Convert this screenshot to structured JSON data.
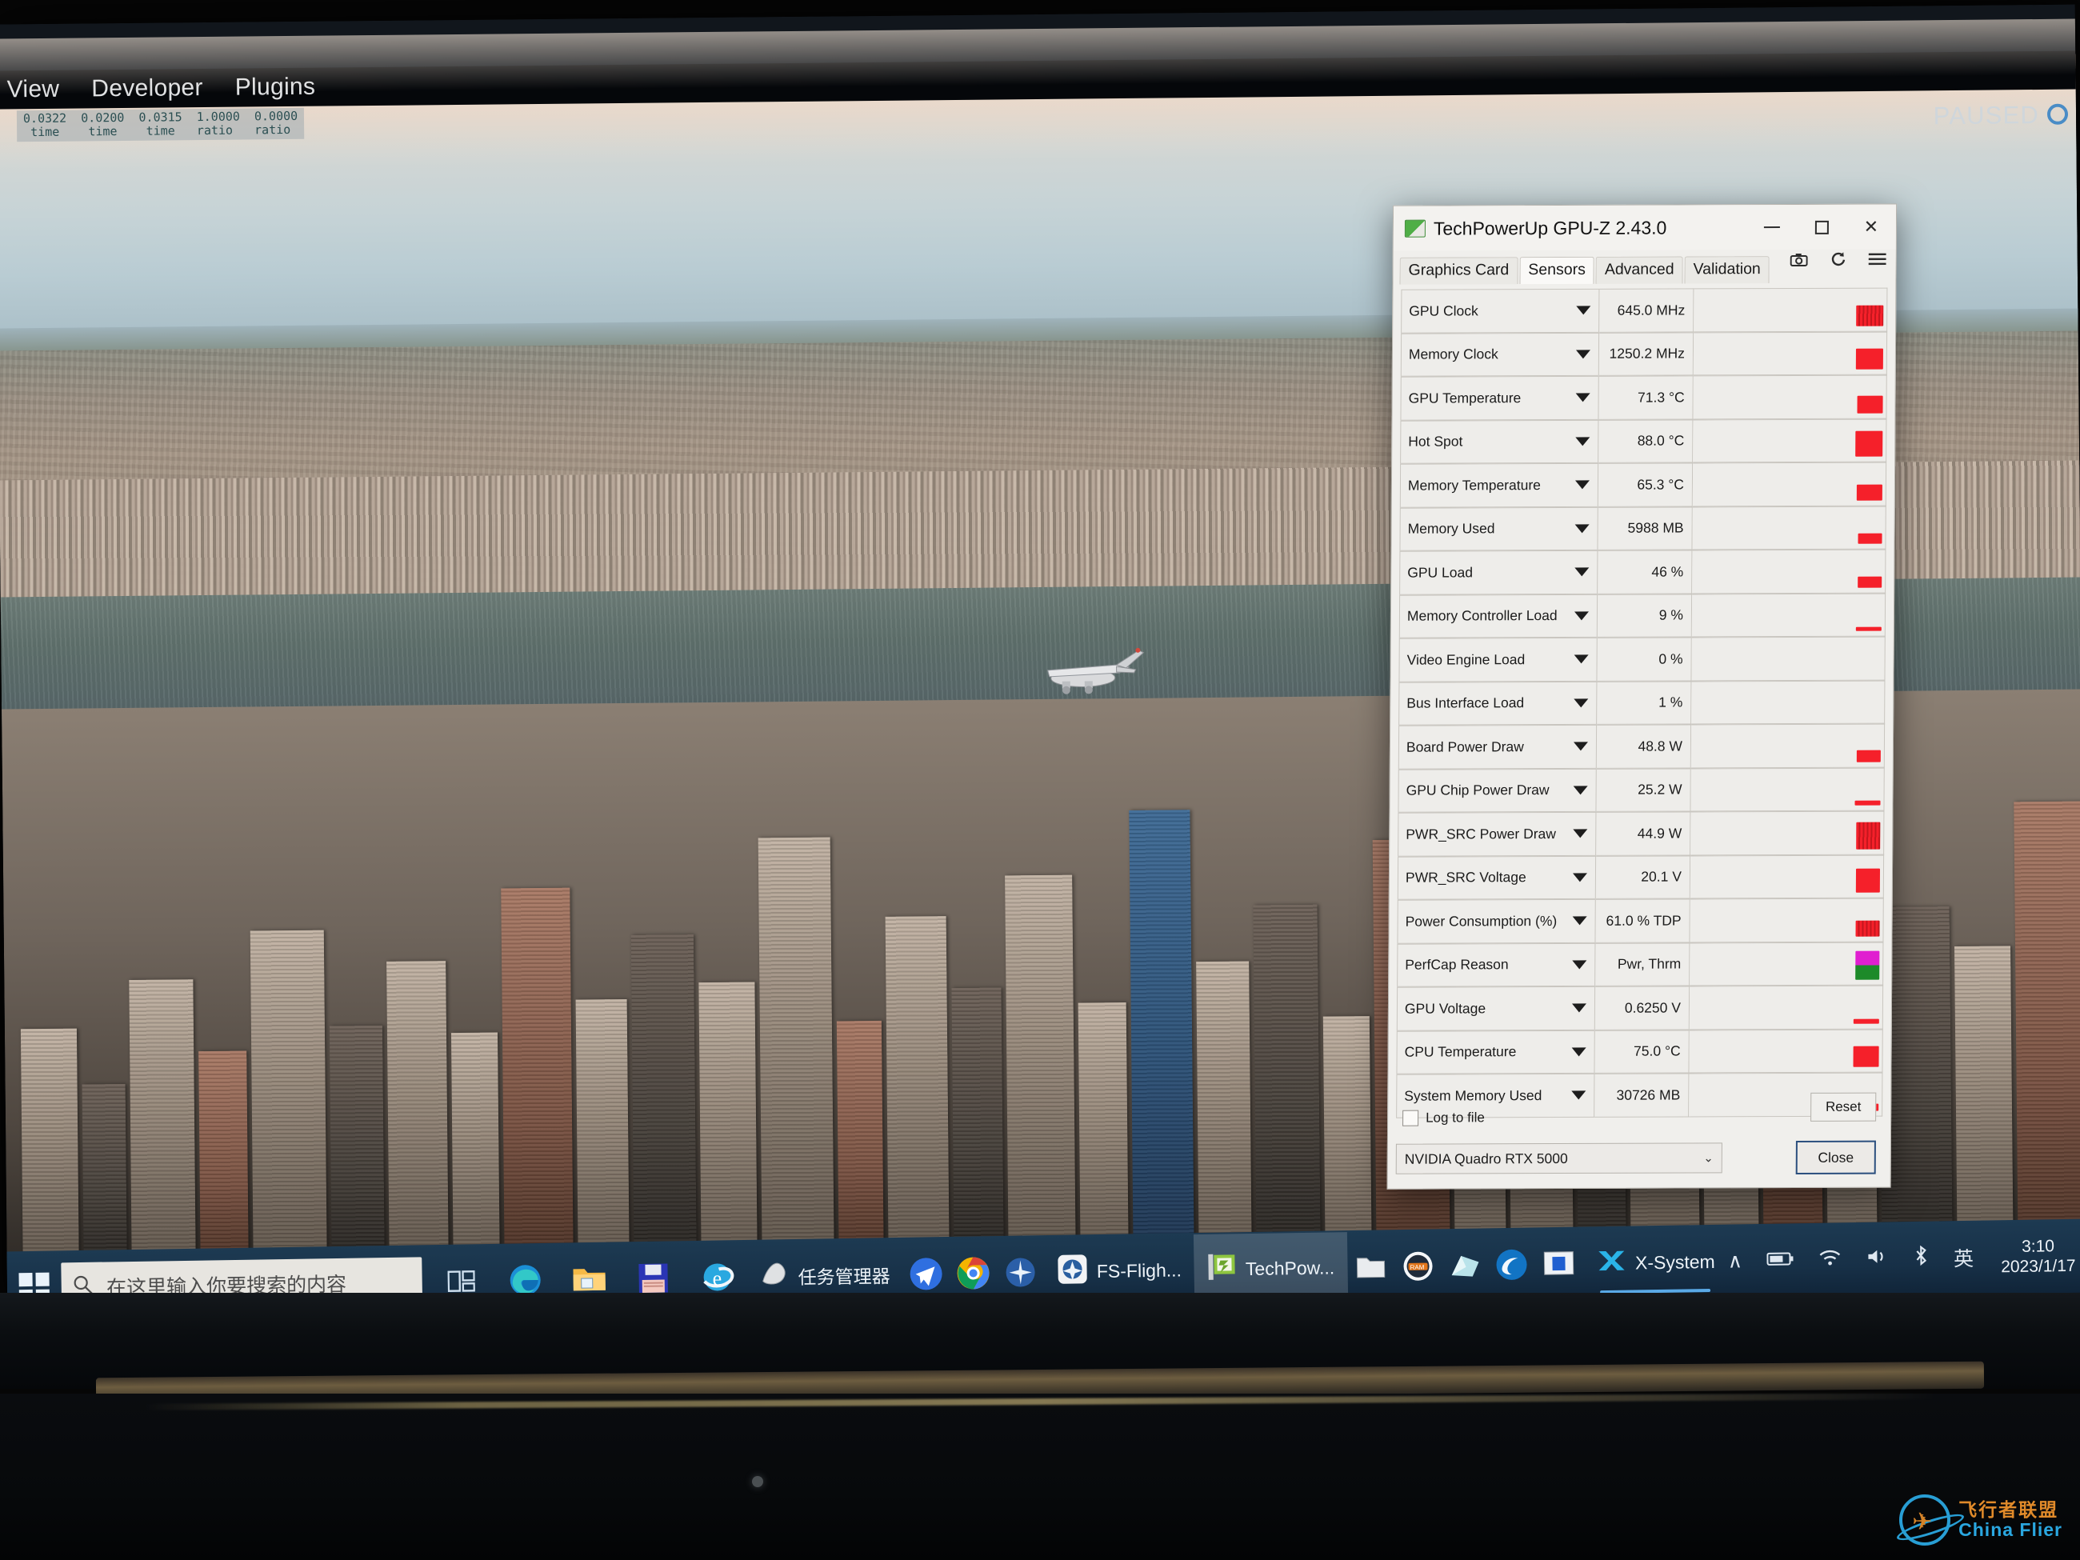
{
  "sim": {
    "menu": [
      {
        "label": "View"
      },
      {
        "label": "Developer"
      },
      {
        "label": "Plugins"
      }
    ],
    "status": "PAUSED",
    "debug_overlay": "0.0322  0.0200  0.0315  1.0000  0.0000\n time    time    time   ratio   ratio"
  },
  "gpuz": {
    "title": "TechPowerUp GPU-Z 2.43.0",
    "window_buttons": {
      "minimize": "—",
      "maximize": "□",
      "close": "✕"
    },
    "tabs": [
      {
        "label": "Graphics Card",
        "active": false
      },
      {
        "label": "Sensors",
        "active": true
      },
      {
        "label": "Advanced",
        "active": false
      },
      {
        "label": "Validation",
        "active": false
      }
    ],
    "tools": [
      {
        "name": "camera-icon",
        "glyph": "📷"
      },
      {
        "name": "refresh-icon",
        "glyph": "⟳"
      },
      {
        "name": "hamburger-menu-icon",
        "glyph": "☰"
      }
    ],
    "sensors": [
      {
        "name": "GPU Clock",
        "value": "645.0 MHz",
        "graph": "jag",
        "w": 34,
        "h": 26
      },
      {
        "name": "Memory Clock",
        "value": "1250.2 MHz",
        "graph": "bar",
        "w": 34,
        "h": 26
      },
      {
        "name": "GPU Temperature",
        "value": "71.3 °C",
        "graph": "bar",
        "w": 32,
        "h": 22
      },
      {
        "name": "Hot Spot",
        "value": "88.0 °C",
        "graph": "bar",
        "w": 34,
        "h": 32
      },
      {
        "name": "Memory Temperature",
        "value": "65.3 °C",
        "graph": "bar",
        "w": 32,
        "h": 20
      },
      {
        "name": "Memory Used",
        "value": "5988 MB",
        "graph": "bar",
        "w": 30,
        "h": 13
      },
      {
        "name": "GPU Load",
        "value": "46 %",
        "graph": "bar",
        "w": 30,
        "h": 14
      },
      {
        "name": "Memory Controller Load",
        "value": "9 %",
        "graph": "bar",
        "w": 32,
        "h": 5
      },
      {
        "name": "Video Engine Load",
        "value": "0 %",
        "graph": "none",
        "w": 0,
        "h": 0
      },
      {
        "name": "Bus Interface Load",
        "value": "1 %",
        "graph": "none",
        "w": 0,
        "h": 0
      },
      {
        "name": "Board Power Draw",
        "value": "48.8 W",
        "graph": "bar",
        "w": 30,
        "h": 15
      },
      {
        "name": "GPU Chip Power Draw",
        "value": "25.2 W",
        "graph": "bar",
        "w": 32,
        "h": 6
      },
      {
        "name": "PWR_SRC Power Draw",
        "value": "44.9 W",
        "graph": "jag",
        "w": 30,
        "h": 34
      },
      {
        "name": "PWR_SRC Voltage",
        "value": "20.1 V",
        "graph": "bar",
        "w": 30,
        "h": 30
      },
      {
        "name": "Power Consumption (%)",
        "value": "61.0 % TDP",
        "graph": "jag",
        "w": 30,
        "h": 20
      },
      {
        "name": "PerfCap Reason",
        "value": "Pwr, Thrm",
        "graph": "perf",
        "w": 30,
        "h": 36
      },
      {
        "name": "GPU Voltage",
        "value": "0.6250 V",
        "graph": "bar",
        "w": 32,
        "h": 6
      },
      {
        "name": "CPU Temperature",
        "value": "75.0 °C",
        "graph": "bar",
        "w": 32,
        "h": 26
      },
      {
        "name": "System Memory Used",
        "value": "30726 MB",
        "graph": "bar",
        "w": 30,
        "h": 9
      }
    ],
    "footer": {
      "log_to_file": "Log to file",
      "reset_label": "Reset",
      "device": "NVIDIA Quadro RTX 5000",
      "device_chevron": "⌄",
      "close_label": "Close"
    }
  },
  "taskbar": {
    "start": "start-button",
    "search_placeholder": "在这里输入你要搜索的内容",
    "search_icon": "⚲",
    "pinned": [
      {
        "name": "task-view-icon",
        "glyph": "⌸"
      },
      {
        "name": "edge-icon",
        "glyph": "◐"
      },
      {
        "name": "file-explorer-icon",
        "glyph": "🗀"
      },
      {
        "name": "save-floppy-icon",
        "glyph": "💾"
      },
      {
        "name": "internet-explorer-icon",
        "glyph": "e"
      }
    ],
    "apps": [
      {
        "name": "task-manager",
        "label": "任务管理器",
        "active": false
      },
      {
        "name": "telegram",
        "label": "",
        "active": false
      },
      {
        "name": "chrome",
        "label": "",
        "active": false
      },
      {
        "name": "xplane-launcher",
        "label": "",
        "active": false
      },
      {
        "name": "fs-flight",
        "label": "FS-Fligh...",
        "active": false
      },
      {
        "name": "techpowerup-gpuz",
        "label": "TechPow...",
        "active": true
      }
    ],
    "tray_apps": [
      {
        "name": "folder-tray-icon",
        "glyph": "🗀"
      },
      {
        "name": "ram-tray-icon",
        "glyph": "◉"
      },
      {
        "name": "onedrive-tray-icon",
        "glyph": "◢"
      },
      {
        "name": "nvidia-tray-icon",
        "glyph": "◔"
      },
      {
        "name": "display-tray-icon",
        "glyph": "▣"
      }
    ],
    "xsystem_label": "X-System",
    "tray": [
      {
        "name": "show-hidden-icons",
        "glyph": "∧"
      },
      {
        "name": "battery-icon",
        "glyph": "🔋"
      },
      {
        "name": "wifi-icon",
        "glyph": "◠"
      },
      {
        "name": "volume-icon",
        "glyph": "🔊"
      },
      {
        "name": "bluetooth-icon",
        "glyph": "⎇"
      },
      {
        "name": "ime-indicator",
        "glyph": "英"
      }
    ],
    "clock_time": "3:10",
    "clock_date": "2023/1/17"
  },
  "watermark": {
    "cn": "飞行者联盟",
    "en": "China Flier"
  },
  "colors": {
    "accent": "#2aa7e0",
    "taskbar": "#173047",
    "sensor_red": "#f5202a",
    "perfcap_magenta": "#e01fd0",
    "perfcap_green": "#1d8a29"
  }
}
